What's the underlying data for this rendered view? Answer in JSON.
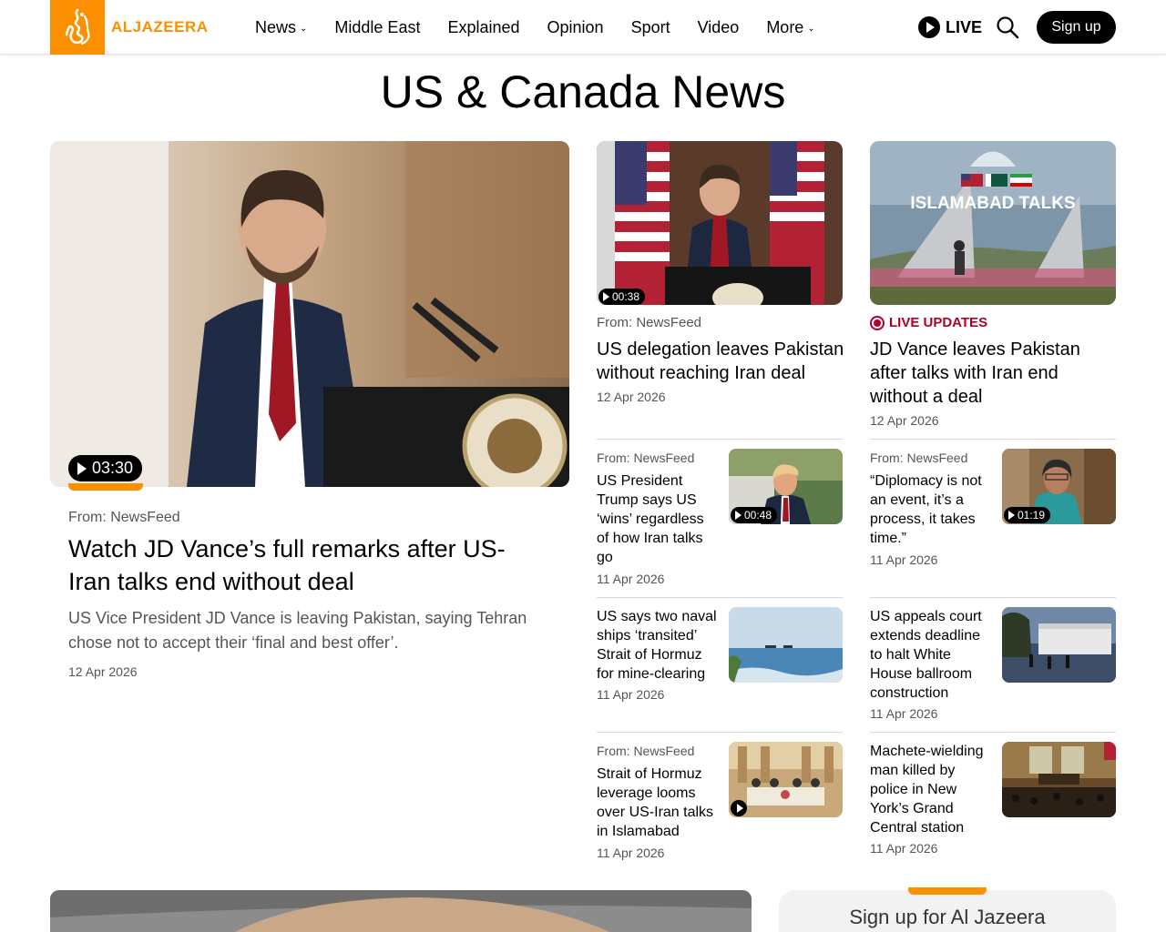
{
  "header": {
    "logo_text": "ALJAZEERA",
    "nav": [
      {
        "label": "News",
        "dropdown": true
      },
      {
        "label": "Middle East",
        "dropdown": false
      },
      {
        "label": "Explained",
        "dropdown": false
      },
      {
        "label": "Opinion",
        "dropdown": false
      },
      {
        "label": "Sport",
        "dropdown": false
      },
      {
        "label": "Video",
        "dropdown": false
      },
      {
        "label": "More",
        "dropdown": true
      }
    ],
    "live_label": "LIVE",
    "signup_label": "Sign up",
    "colors": {
      "brand": "#fa9000",
      "live_red": "#b0002a"
    }
  },
  "page_title": "US & Canada News",
  "main_story": {
    "duration": "03:30",
    "source": "From: NewsFeed",
    "headline": "Watch JD Vance’s full remarks after US-Iran talks end without deal",
    "summary": "US Vice President JD Vance is leaving Pakistan, saying Tehran chose not to accept their ‘final and best offer’.",
    "date": "12 Apr 2026"
  },
  "top_cards": [
    {
      "duration": "00:38",
      "source": "From: NewsFeed",
      "headline": "US delegation leaves Pakistan without reaching Iran deal",
      "date": "12 Apr 2026"
    },
    {
      "badge": "LIVE UPDATES",
      "image_text": "ISLAMABAD TALKS",
      "headline": "JD Vance leaves Pakistan after talks with Iran end without a deal",
      "date": "12 Apr 2026"
    }
  ],
  "list_left": [
    {
      "source": "From: NewsFeed",
      "headline": "US President Trump says US ‘wins’ regardless of how Iran talks go",
      "date": "11 Apr 2026",
      "duration": "00:48"
    },
    {
      "headline": "US says two naval ships ‘transited’ Strait of Hormuz for mine-clearing",
      "date": "11 Apr 2026"
    },
    {
      "source": "From: NewsFeed",
      "headline": "Strait of Hormuz leverage looms over US-Iran talks in Islamabad",
      "date": "11 Apr 2026"
    }
  ],
  "list_right": [
    {
      "source": "From: NewsFeed",
      "headline": "“Diplomacy is not an event, it’s a process, it takes time.”",
      "date": "11 Apr 2026",
      "duration": "01:19"
    },
    {
      "headline": "US appeals court extends deadline to halt White House ballroom construction",
      "date": "11 Apr 2026"
    },
    {
      "headline": "Machete-wielding man killed by police in New York’s Grand Central station",
      "date": "11 Apr 2026"
    }
  ],
  "signup_box": {
    "title": "Sign up for Al Jazeera"
  }
}
